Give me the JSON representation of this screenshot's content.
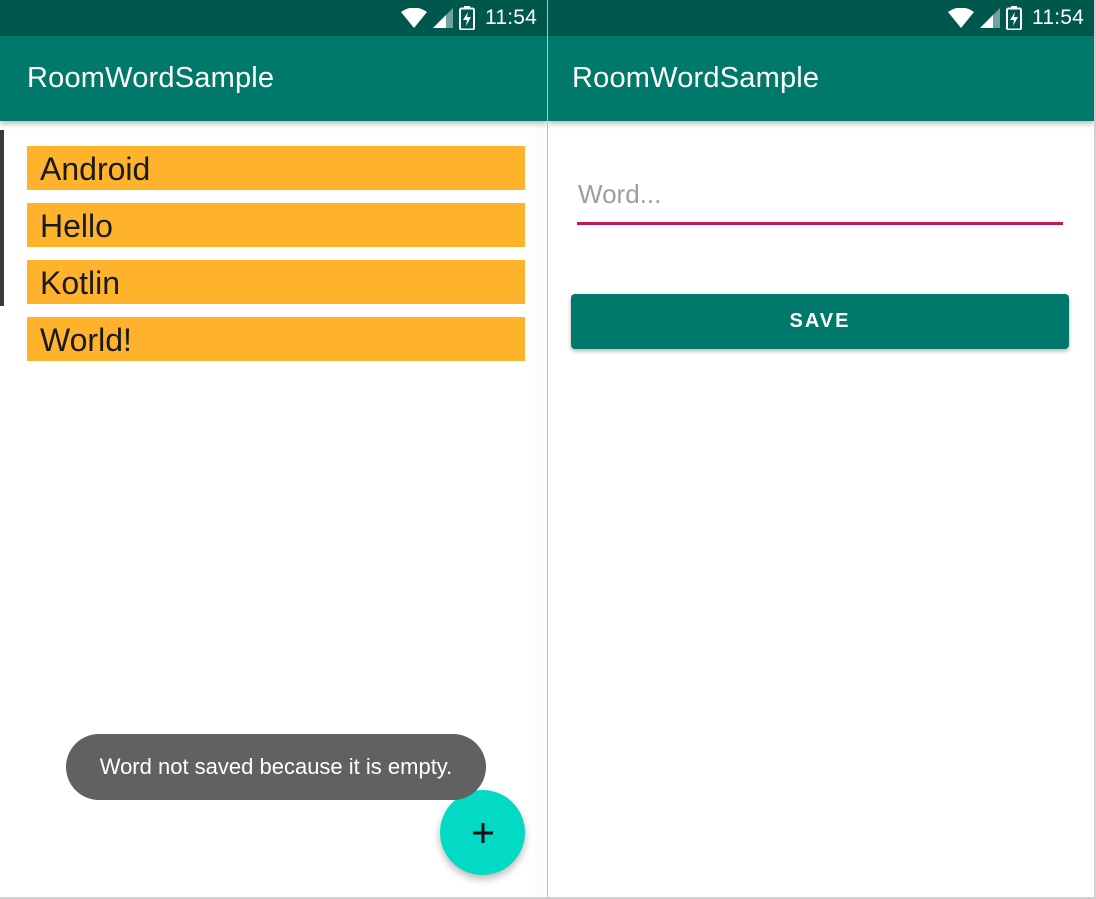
{
  "status_bar": {
    "time": "11:54",
    "icons": [
      "wifi-icon",
      "signal-icon",
      "battery-charging-icon"
    ]
  },
  "left_screen": {
    "app_title": "RoomWordSample",
    "words": [
      {
        "label": "Android"
      },
      {
        "label": "Hello"
      },
      {
        "label": "Kotlin"
      },
      {
        "label": "World!"
      }
    ],
    "toast": "Word not saved because it is empty.",
    "fab": {
      "icon": "plus-icon",
      "label": "+"
    }
  },
  "right_screen": {
    "app_title": "RoomWordSample",
    "word_input": {
      "placeholder": "Word...",
      "value": ""
    },
    "save_label": "SAVE"
  },
  "colors": {
    "status_bar": "#00574b",
    "app_bar": "#00796b",
    "word_item_bg": "#ffb32d",
    "fab": "#03dac5",
    "toast": "#616161",
    "input_underline": "#c2185b",
    "save_button": "#00796b"
  }
}
